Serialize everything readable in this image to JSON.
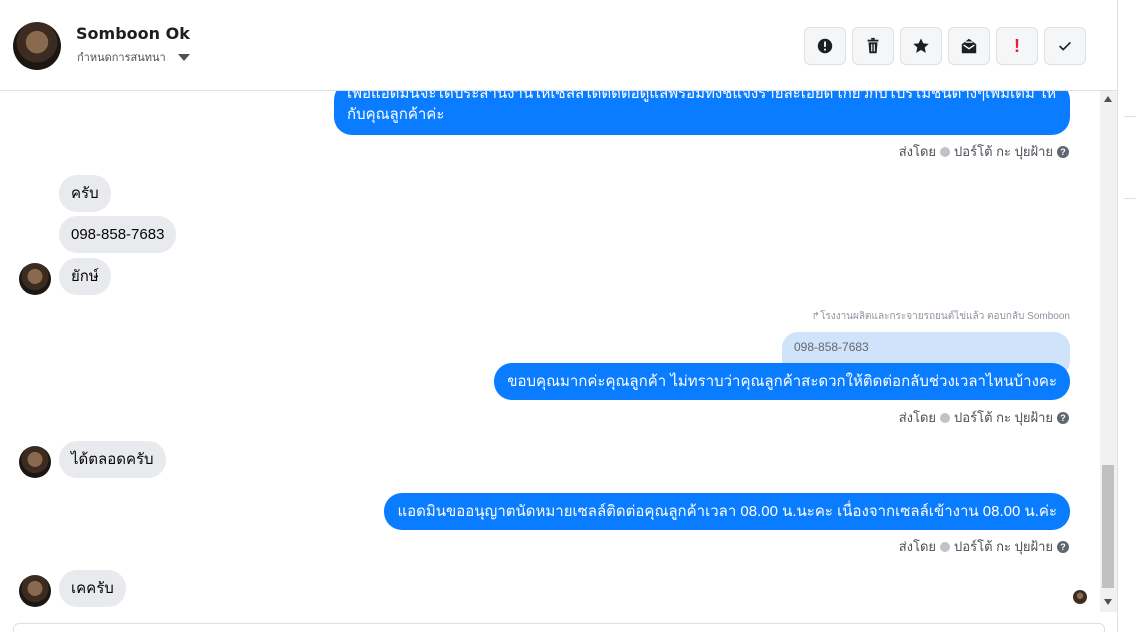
{
  "header": {
    "name": "Somboon Ok",
    "assign_label": "กำหนดการสนทนา"
  },
  "toolbar": {
    "icons": [
      "alert-circle-icon",
      "trash-icon",
      "star-icon",
      "mark-unread-icon",
      "exclamation-icon",
      "checkmark-icon"
    ],
    "bang": "!"
  },
  "messages": {
    "out1_line1": "เพื่อแอดมินจะได้ประสานงานให้เซลล์ได้ติดต่อดูแลพร้อมทั้งชี้แจงรายละเอียด เกี่ยวกับโปรโมชั่นต่างๆเพิ่มเติม ให้",
    "out1_line2": "กับคุณลูกค้าค่ะ",
    "in1": "ครับ",
    "in2": "098-858-7683",
    "in3": "ยักษ์",
    "reply_note": "โรงงานผลิตและกระจายรถยนต์ไข่แล้ว ตอบกลับ Somboon",
    "quoted": "098-858-7683",
    "out2": "ขอบคุณมากค่ะคุณลูกค้า ไม่ทราบว่าคุณลูกค้าสะดวกให้ติดต่อกลับช่วงเวลาไหนบ้างคะ",
    "in4": "ได้ตลอดครับ",
    "out3": "แอดมินขออนุญาตนัดหมายเซลล์ติดต่อคุณลูกค้าเวลา 08.00 น.นะคะ เนื่องจากเซลล์เข้างาน 08.00 น.ค่ะ",
    "in5": "เคครับ"
  },
  "meta": {
    "sent_by": "ส่งโดย",
    "sender": "ปอร์โต้ กะ ปุยฝ้าย",
    "help": "?"
  }
}
